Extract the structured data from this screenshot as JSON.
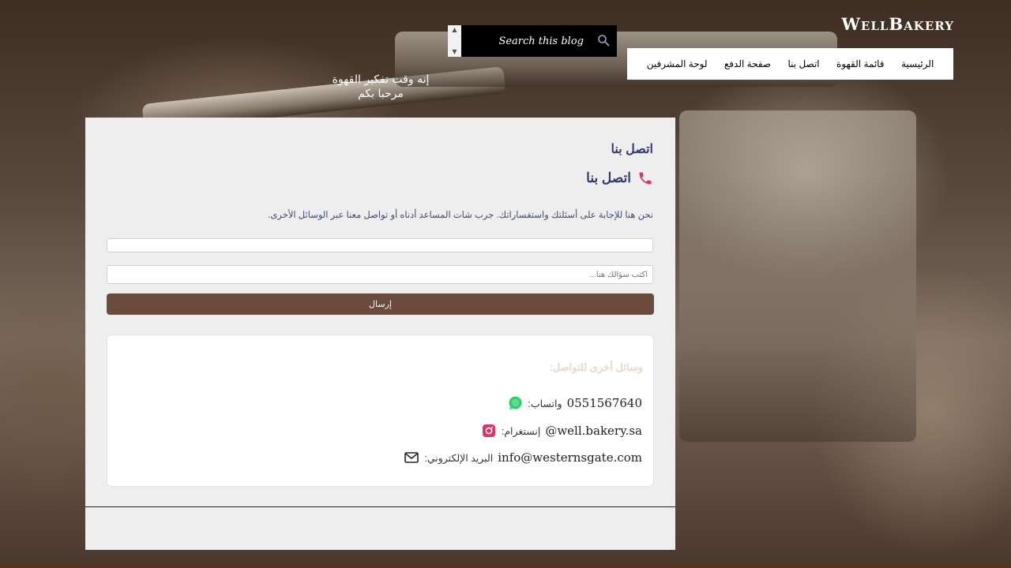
{
  "brand": {
    "name": "WellBakery"
  },
  "search": {
    "placeholder": "Search this blog"
  },
  "tagline": {
    "line1": "إنه وقت تفكير القهوة",
    "line2": "مرحبا بكم"
  },
  "nav": {
    "items": [
      {
        "label": "الرئيسية"
      },
      {
        "label": "قائمة القهوة"
      },
      {
        "label": "اتصل بنا"
      },
      {
        "label": "صفحة الدفع"
      },
      {
        "label": "لوحة المشرفين"
      }
    ]
  },
  "page": {
    "title": "اتصل بنا",
    "heading": "اتصل بنا",
    "intro": "نحن هنا للإجابة على أسئلتك واستفساراتك. جرب شات المساعد أدناه أو تواصل معنا عبر الوسائل الأخرى."
  },
  "form": {
    "question_placeholder": "اكتب سؤالك هنا...",
    "send_label": "إرسال"
  },
  "other_channels": {
    "title": "وسائل أخرى للتواصل:",
    "whatsapp": {
      "label": "واتساب:",
      "value": "0551567640"
    },
    "instagram": {
      "label": "إنستغرام:",
      "value": "@well.bakery.sa"
    },
    "email": {
      "label": "البريد الإلكتروني:",
      "value": "info@westernsgate.com"
    }
  },
  "colors": {
    "heading": "#333a6e",
    "button": "#6b4b3e",
    "phone_icon": "#e0306e",
    "whatsapp_icon": "#25d366",
    "instagram_icon": "#e1306c"
  }
}
